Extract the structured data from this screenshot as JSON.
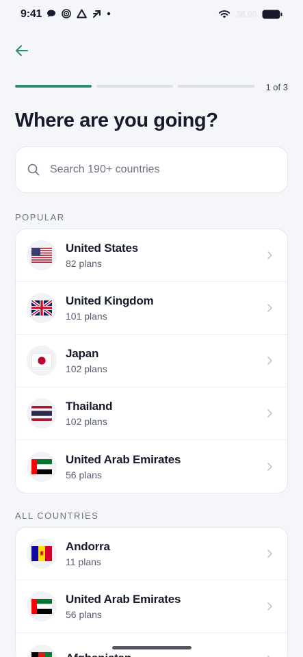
{
  "status_bar": {
    "time": "9:41",
    "signal_text": "36.00",
    "icons_left": [
      "chat-bubble-icon",
      "target-icon",
      "triangle-icon",
      "arrow-icon",
      "dot-icon"
    ],
    "icons_right": [
      "wifi-icon",
      "battery-icon"
    ]
  },
  "header": {
    "back_icon": "arrow-left-icon",
    "progress": {
      "current": 1,
      "total": 3
    },
    "step_label": "1 of 3",
    "title": "Where are you going?"
  },
  "search": {
    "placeholder": "Search 190+ countries",
    "value": ""
  },
  "popular": {
    "label": "POPULAR",
    "items": [
      {
        "name": "United States",
        "plans": "82 plans",
        "flag": "us"
      },
      {
        "name": "United Kingdom",
        "plans": "101 plans",
        "flag": "gb"
      },
      {
        "name": "Japan",
        "plans": "102 plans",
        "flag": "jp"
      },
      {
        "name": "Thailand",
        "plans": "102 plans",
        "flag": "th"
      },
      {
        "name": "United Arab Emirates",
        "plans": "56 plans",
        "flag": "ae"
      }
    ]
  },
  "all_countries": {
    "label": "ALL COUNTRIES",
    "items": [
      {
        "name": "Andorra",
        "plans": "11 plans",
        "flag": "ad"
      },
      {
        "name": "United Arab Emirates",
        "plans": "56 plans",
        "flag": "ae"
      },
      {
        "name": "Afghanistan",
        "plans": "",
        "flag": "af"
      }
    ]
  },
  "colors": {
    "accent": "#2e8b73",
    "background": "#f5f6f9",
    "text": "#151b2b"
  }
}
